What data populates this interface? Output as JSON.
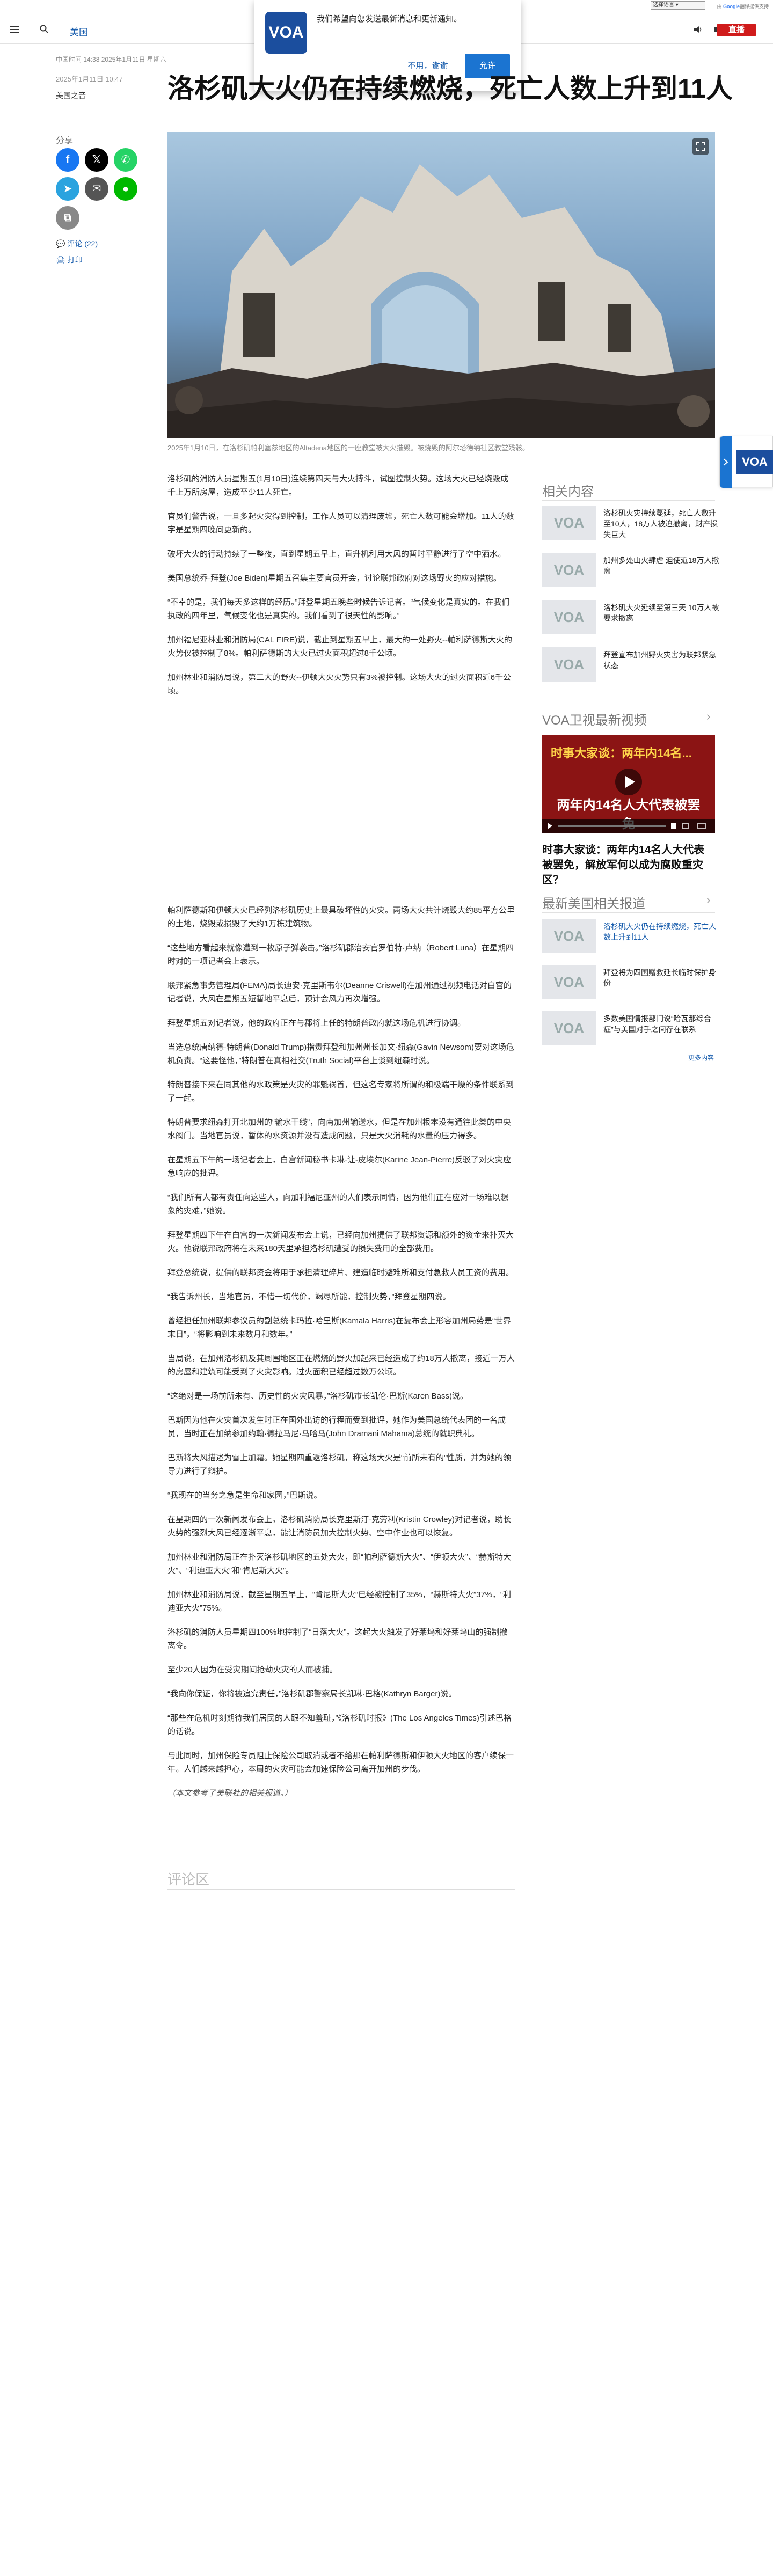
{
  "topbar": {
    "lang_select": "选择语言",
    "powered_prefix": "由",
    "powered_brand": "Google",
    "powered_suffix": "翻译提供支持"
  },
  "header": {
    "nav_label": "美国",
    "live_label": "直播"
  },
  "popup": {
    "logo": "VOA",
    "message": "我们希望向您发送最新消息和更新通知。",
    "decline": "不用，谢谢",
    "accept": "允许"
  },
  "article": {
    "meta": "中国时间 14:38 2025年1月11日 星期六",
    "date": "2025年1月11日 10:47",
    "byline": "美国之音",
    "title": "洛杉矶大火仍在持续燃烧，死亡人数上升到11人",
    "share_label": "分享",
    "comment_link": "评论 (22)",
    "print_link": "打印",
    "caption": "2025年1月10日，在洛杉矶帕利塞兹地区的Altadena地区的一座教堂被大火摧毁。被烧毁的阿尔塔德纳社区教堂残骸。",
    "paragraphs": [
      "洛杉矶的消防人员星期五(1月10日)连续第四天与大火搏斗，试图控制火势。这场大火已经烧毁成千上万所房屋，造成至少11人死亡。",
      "官员们警告说，一旦多起火灾得到控制，工作人员可以清理废墟，死亡人数可能会增加。11人的数字是星期四晚间更新的。",
      "破坏大火的行动持续了一整夜，直到星期五早上，直升机利用大风的暂时平静进行了空中洒水。",
      "美国总统乔·拜登(Joe Biden)星期五召集主要官员开会，讨论联邦政府对这场野火的应对措施。",
      "“不幸的是，我们每天多这样的经历。”拜登星期五晚些时候告诉记者。“气候变化是真实的。在我们执政的四年里，气候变化也是真实的。我们看到了很天性的影响。”",
      "加州福尼亚林业和消防局(CAL FIRE)说，截止到星期五早上，最大的一处野火--帕利萨德斯大火的火势仅被控制了8%。帕利萨德斯的大火已过火面积超过8千公顷。",
      "加州林业和消防局说，第二大的野火--伊顿大火火势只有3%被控制。这场大火的过火面积近6千公顷。",
      "帕利萨德斯和伊顿大火已经列洛杉矶历史上最具破坏性的火灾。两场大火共计烧毁大约85平方公里的土地，烧毁或损毁了大约1万栋建筑物。",
      "“这些地方看起来就像遭到一枚原子弹袭击。”洛杉矶郡治安官罗伯特·卢纳（Robert Luna）在星期四时对的一项记者会上表示。",
      "联邦紧急事务管理局(FEMA)局长迪安·克里斯韦尔(Deanne Criswell)在加州通过视频电话对白宫的记者说，大风在星期五短暂地平息后，预计会风力再次增强。",
      "拜登星期五对记者说，他的政府正在与郡将上任的特朗普政府就这场危机进行协调。",
      "当选总统唐纳德·特朗普(Donald Trump)指责拜登和加州州长加文·纽森(Gavin Newsom)要对这场危机负责。“这要怪他，”特朗普在真相社交(Truth Social)平台上谈到纽森时说。",
      "特朗普接下来在同其他的水政策是火灾的罪魁祸首，但这名专家将所谓的和极端干燥的条件联系到了一起。",
      "特朗普要求纽森打开北加州的“输水干线”，向南加州输送水，但是在加州根本没有通往此类的中央水阀门。当地官员说，暂体的水资源并没有造成问题，只是大火消耗的水量的压力得多。",
      "在星期五下午的一场记者会上，白宫新闻秘书卡琳·让-皮埃尔(Karine Jean-Pierre)反驳了对火灾应急响应的批评。",
      "“我们所有人都有责任向这些人，向加利福尼亚州的人们表示同情，因为他们正在应对一场难以想象的灾难，”她说。",
      "拜登星期四下午在白宫的一次新闻发布会上说，已经向加州提供了联邦资源和额外的资金来扑灭大火。他说联邦政府将在未来180天里承担洛杉矶遭受的损失费用的全部费用。",
      "拜登总统说，提供的联邦资金将用于承担清理碎片、建造临时避难所和支付急救人员工资的费用。",
      "“我告诉州长，当地官员，不惜一切代价，竭尽所能，控制火势，”拜登星期四说。",
      "曾经担任加州联邦参议员的副总统卡玛拉·哈里斯(Kamala Harris)在复布会上形容加州局势是“世界末日”，“将影响到未来数月和数年。”",
      "当局说，在加州洛杉矶及其周围地区正在燃烧的野火加起来已经造成了约18万人撤离，接近一万人的房屋和建筑可能受到了火灾影响。过火面积已经超过数万公顷。",
      "“这绝对是一场前所未有、历史性的火灾风暴，”洛杉矶市长凯伦·巴斯(Karen Bass)说。",
      "巴斯因为他在火灾首次发生时正在国外出访的行程而受到批评，她作为美国总统代表团的一名成员，当时正在加纳参加约翰·德拉马尼·马哈马(John Dramani Mahama)总统的就职典礼。",
      "巴斯将大风描述为雪上加霜。她星期四重返洛杉矶，称这场大火是“前所未有的”性质，并为她的领导力进行了辩护。",
      "“我现在的当务之急是生命和家园，”巴斯说。",
      "在星期四的一次新闻发布会上，洛杉矶消防局长克里斯汀·克劳利(Kristin Crowley)对记者说，助长火势的强烈大风已经逐渐平息，能让消防员加大控制火势、空中作业也可以恢复。",
      "加州林业和消防局正在扑灭洛杉矶地区的五处大火，即“帕利萨德斯大火”、“伊顿大火”、“赫斯特大火”、“利迪亚大火”和“肯尼斯大火”。",
      "加州林业和消防局说，截至星期五早上，“肯尼斯大火”已经被控制了35%，“赫斯特大火”37%，“利迪亚大火”75%。",
      "洛杉矶的消防人员星期四100%地控制了“日落大火”。这起大火触发了好莱坞和好莱坞山的强制撤离令。",
      "至少20人因为在受灾期间抢劫火灾的人而被捕。",
      "“我向你保证，你将被追究责任，”洛杉矶郡警察局长凯琳·巴格(Kathryn Barger)说。",
      "“那些在危机时刻期待我们居民的人跟不知羞耻，”《洛杉矶时报》(The Los Angeles Times)引述巴格的话说。",
      "与此同时，加州保险专员阻止保险公司取消或者不给那在帕利萨德斯和伊顿大火地区的客户续保一年。人们越来越担心，本周的火灾可能会加速保险公司离开加州的步伐。"
    ],
    "note": "（本文参考了美联社的相关报道。）",
    "comments_title": "评论区"
  },
  "sidebar": {
    "related_title": "相关内容",
    "related": [
      {
        "thumb": "VOA",
        "text": "洛杉矶火灾持续蔓延，死亡人数升至10人，18万人被迫撤离，财产损失巨大"
      },
      {
        "thumb": "VOA",
        "text": "加州多处山火肆虐 迫使近18万人撤离"
      },
      {
        "thumb": "VOA",
        "text": "洛杉矶大火延续至第三天 10万人被要求撤离"
      },
      {
        "thumb": "VOA",
        "text": "拜登宣布加州野火灾害为联邦紧急状态"
      }
    ],
    "video_title": "VOA卫视最新视频",
    "video_overlay_top": "时事大家谈：两年内14名...",
    "video_overlay_main": "两年内14名人大代表被罢免",
    "video_caption": "时事大家谈：两年内14名人大代表被罢免，解放军何以成为腐败重灾区？",
    "us_title": "最新美国相关报道",
    "us": [
      {
        "thumb": "VOA",
        "text": "洛杉矶大火仍在持续燃烧，死亡人数上升到11人"
      },
      {
        "thumb": "VOA",
        "text": "拜登将为四国赠救延长临时保护身份"
      },
      {
        "thumb": "VOA",
        "text": "多数美国情报部门说“哈瓦那综合症”与美国对手之间存在联系"
      }
    ],
    "more_link": "更多内容"
  },
  "side_tab": {
    "logo": "VOA"
  },
  "colors": {
    "accent": "#1b5fae",
    "live": "#d01b1b",
    "facebook": "#1877f2",
    "x": "#000000",
    "whatsapp": "#25d366",
    "telegram": "#2aa3df",
    "email": "#555555",
    "line": "#00b900",
    "link": "#888888"
  }
}
